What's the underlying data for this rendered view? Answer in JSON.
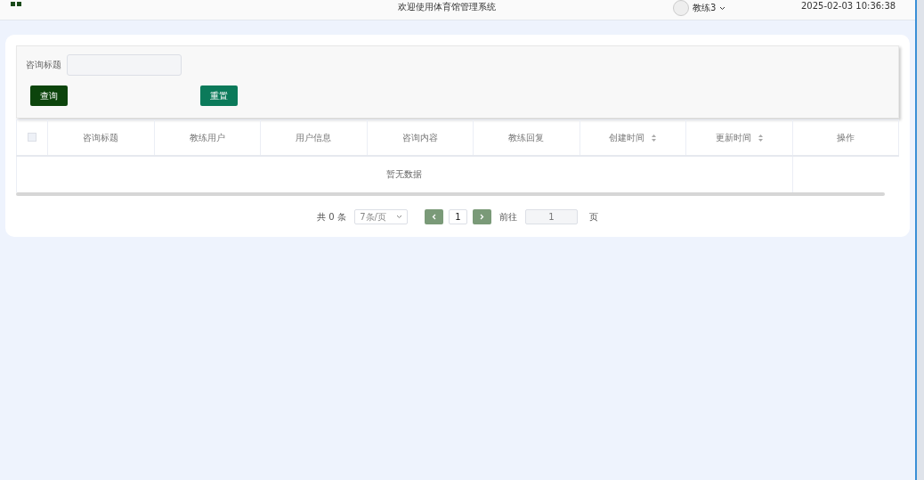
{
  "header": {
    "title": "欢迎使用体育馆管理系统",
    "user": "教练3",
    "datetime": "2025-02-03 10:36:38"
  },
  "search": {
    "label": "咨询标题",
    "buttons": [
      {
        "label": "查询",
        "kind": "primary"
      },
      {
        "label": "重置",
        "kind": "secondary"
      }
    ]
  },
  "table": {
    "select_all": {
      "checked": false
    },
    "columns": [
      {
        "label": "咨询标题",
        "sortable": false
      },
      {
        "label": "教练用户",
        "sortable": false
      },
      {
        "label": "用户信息",
        "sortable": false
      },
      {
        "label": "咨询内容",
        "sortable": false
      },
      {
        "label": "教练回复",
        "sortable": false
      },
      {
        "label": "创建时间",
        "sortable": true
      },
      {
        "label": "更新时间",
        "sortable": true
      },
      {
        "label": "操作",
        "sortable": false
      }
    ],
    "empty_text": "暂无数据"
  },
  "pagination": {
    "total": "共 0 条",
    "page_size": "7条/页",
    "current_page": "1",
    "goto_label": "前往",
    "goto_value": "1",
    "page_suffix": "页"
  }
}
